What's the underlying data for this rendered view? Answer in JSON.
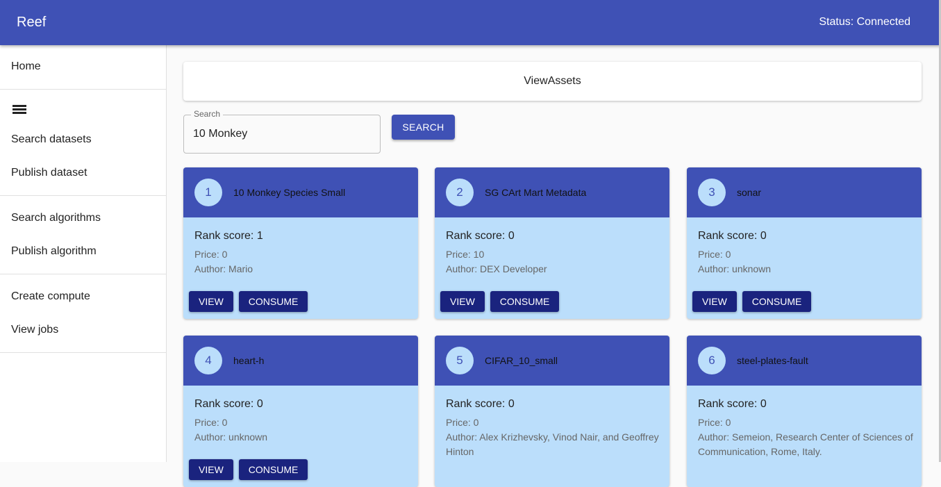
{
  "app": {
    "title": "Reef",
    "status": "Status: Connected"
  },
  "sidebar": {
    "home": "Home",
    "search_datasets": "Search datasets",
    "publish_dataset": "Publish dataset",
    "search_algorithms": "Search algorithms",
    "publish_algorithm": "Publish algorithm",
    "create_compute": "Create compute",
    "view_jobs": "View jobs"
  },
  "header": {
    "title": "ViewAssets"
  },
  "search": {
    "label": "Search",
    "value": "10 Monkey",
    "button": "SEARCH"
  },
  "cards": [
    {
      "index": "1",
      "title": "10 Monkey Species Small",
      "rank": "Rank score: 1",
      "price": "Price: 0",
      "author": "Author: Mario",
      "view": "VIEW",
      "consume": "CONSUME"
    },
    {
      "index": "2",
      "title": "SG CArt Mart Metadata",
      "rank": "Rank score: 0",
      "price": "Price: 10",
      "author": "Author: DEX Developer",
      "view": "VIEW",
      "consume": "CONSUME"
    },
    {
      "index": "3",
      "title": "sonar",
      "rank": "Rank score: 0",
      "price": "Price: 0",
      "author": "Author: unknown",
      "view": "VIEW",
      "consume": "CONSUME"
    },
    {
      "index": "4",
      "title": "heart-h",
      "rank": "Rank score: 0",
      "price": "Price: 0",
      "author": "Author: unknown",
      "view": "VIEW",
      "consume": "CONSUME"
    },
    {
      "index": "5",
      "title": "CIFAR_10_small",
      "rank": "Rank score: 0",
      "price": "Price: 0",
      "author": "Author: Alex Krizhevsky, Vinod Nair, and Geoffrey Hinton",
      "view": "VIEW",
      "consume": "CONSUME"
    },
    {
      "index": "6",
      "title": "steel-plates-fault",
      "rank": "Rank score: 0",
      "price": "Price: 0",
      "author": "Author: Semeion, Research Center of Sciences of Communication, Rome, Italy.",
      "view": "VIEW",
      "consume": "CONSUME"
    }
  ],
  "colors": {
    "primary": "#3f51b5",
    "card_body": "#bbdefb",
    "button_dark": "#1a237e"
  },
  "icons": {
    "datasets_list": "list-icon"
  }
}
